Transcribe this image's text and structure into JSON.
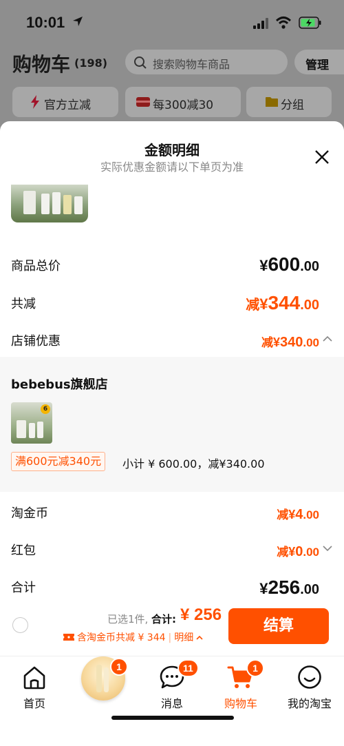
{
  "status_bar": {
    "time": "10:01"
  },
  "header": {
    "title": "购物车",
    "count": "(198)",
    "search_placeholder": "搜索购物车商品",
    "manage": "管理"
  },
  "filters": [
    "官方立减",
    "每300减30",
    "分组"
  ],
  "sheet": {
    "title": "金额明细",
    "subtitle": "实际优惠金额请以下单页为准",
    "rows": {
      "goods_total": {
        "label": "商品总价",
        "symbol": "¥",
        "main": "600",
        "decimal": ".00"
      },
      "total_discount": {
        "label": "共减",
        "prefix": "减",
        "symbol": "¥",
        "main": "344",
        "decimal": ".00"
      },
      "store_discount": {
        "label": "店铺优惠",
        "prefix": "减",
        "symbol": "¥",
        "main": "340",
        "decimal": ".00"
      },
      "gold_coin": {
        "label": "淘金币",
        "prefix": "减",
        "symbol": "¥",
        "main": "4",
        "decimal": ".00"
      },
      "red_packet": {
        "label": "红包",
        "prefix": "减",
        "symbol": "¥",
        "main": "0",
        "decimal": ".00"
      },
      "sum": {
        "label": "合计",
        "symbol": "¥",
        "main": "256",
        "decimal": ".00"
      }
    },
    "shop": {
      "name": "bebebus旗舰店",
      "thumb_badge": "6",
      "promo_tag": "满600元减340元",
      "subtotal": "小计 ¥ 600.00，减¥340.00"
    }
  },
  "pay_bar": {
    "selected": "已选1件,",
    "total_label": "合计:",
    "total_value": "¥ 256",
    "discount_line": "含淘金币共减 ¥ 344",
    "detail": "明细",
    "checkout": "结算"
  },
  "tabbar": {
    "home": "首页",
    "promo_badge": "1",
    "messages": "消息",
    "messages_badge": "11",
    "cart": "购物车",
    "cart_badge": "1",
    "mine": "我的淘宝"
  },
  "colors": {
    "accent": "#ff5000"
  }
}
